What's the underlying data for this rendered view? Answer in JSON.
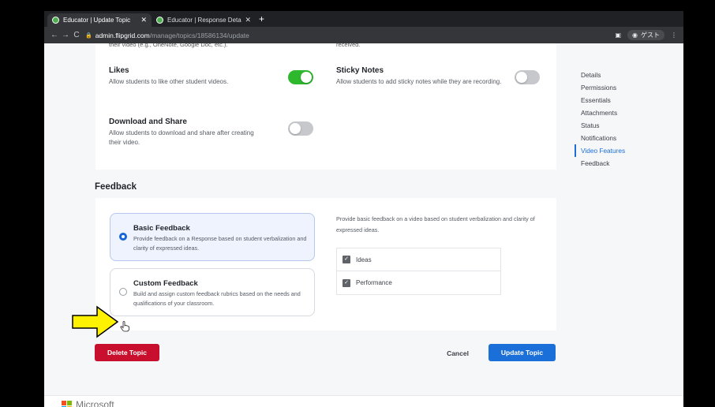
{
  "browser": {
    "tabs": [
      {
        "title": "Educator | Update Topic",
        "active": true
      },
      {
        "title": "Educator | Response Details",
        "active": false
      }
    ],
    "url_domain": "admin.flipgrid.com",
    "url_path": "/manage/topics/18586134/update",
    "profile_label": "ゲスト"
  },
  "video_features": {
    "cut_text_left": "their video (e.g., OneNote, Google Doc, etc.).",
    "cut_text_right": "received.",
    "likes": {
      "title": "Likes",
      "desc": "Allow students to like other student videos.",
      "enabled": true
    },
    "sticky_notes": {
      "title": "Sticky Notes",
      "desc": "Allow students to add sticky notes while they are recording.",
      "enabled": false
    },
    "download_share": {
      "title": "Download and Share",
      "desc": "Allow students to download and share after creating their video.",
      "enabled": false
    }
  },
  "feedback": {
    "heading": "Feedback",
    "basic": {
      "title": "Basic Feedback",
      "desc": "Provide feedback on a Response based on student verbalization and clarity of expressed ideas.",
      "selected": true
    },
    "custom": {
      "title": "Custom Feedback",
      "desc": "Build and assign custom feedback rubrics based on the needs and qualifications of your classroom.",
      "selected": false
    },
    "basic_desc": "Provide basic feedback on a video based on student verbalization and clarity of expressed ideas.",
    "criteria": [
      "Ideas",
      "Performance"
    ]
  },
  "actions": {
    "delete": "Delete Topic",
    "cancel": "Cancel",
    "update": "Update Topic"
  },
  "sidenav": {
    "items": [
      "Details",
      "Permissions",
      "Essentials",
      "Attachments",
      "Status",
      "Notifications",
      "Video Features",
      "Feedback"
    ],
    "active": "Video Features"
  },
  "footer": {
    "brand": "Microsoft"
  },
  "colors": {
    "toggle_on": "#2eb82e",
    "primary": "#1b6fd8",
    "danger": "#c8102e"
  }
}
